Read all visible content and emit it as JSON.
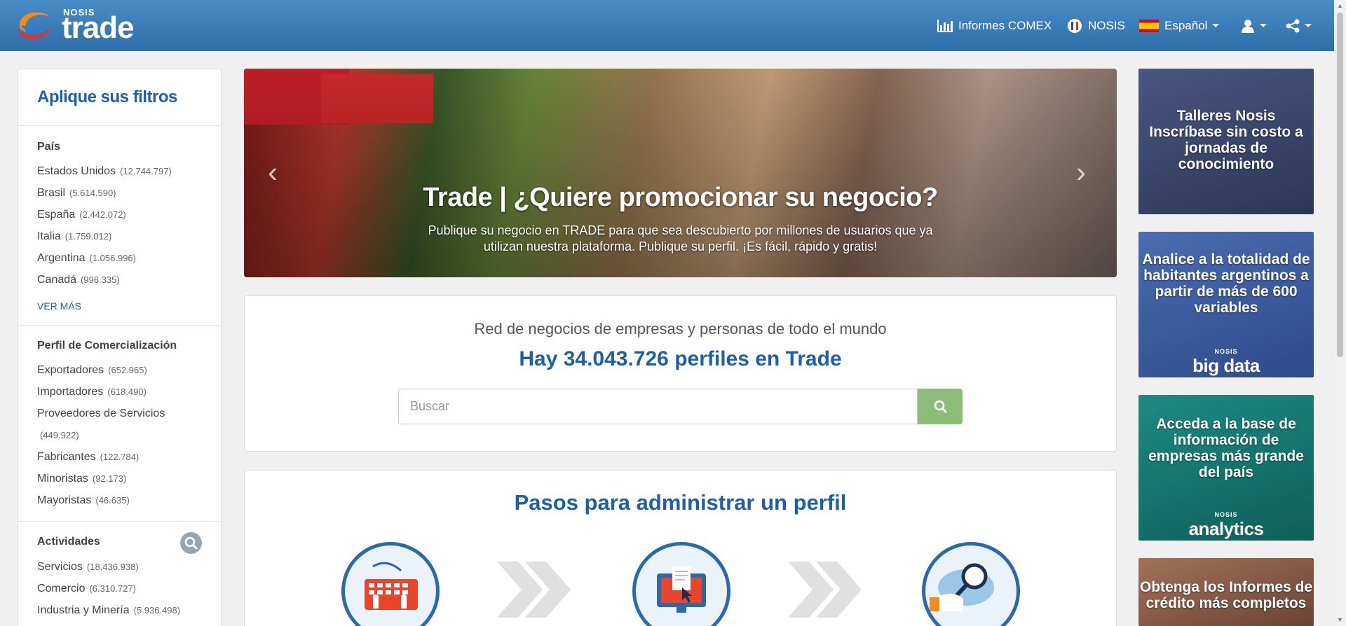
{
  "header": {
    "logo_small": "NOSIS",
    "logo_big": "trade",
    "nav": {
      "informes": "Informes COMEX",
      "nosis": "NOSIS",
      "language": "Español"
    },
    "icons": [
      "bar-chart-icon",
      "nosis-logo-icon",
      "spain-flag-icon",
      "user-icon",
      "share-icon"
    ]
  },
  "sidebar": {
    "title": "Aplique sus filtros",
    "pais": {
      "heading": "País",
      "items": [
        {
          "label": "Estados Unidos",
          "count": "(12.744.797)"
        },
        {
          "label": "Brasil",
          "count": "(5.614.590)"
        },
        {
          "label": "España",
          "count": "(2.442.072)"
        },
        {
          "label": "Italia",
          "count": "(1.759.012)"
        },
        {
          "label": "Argentina",
          "count": "(1.056.996)"
        },
        {
          "label": "Canadá",
          "count": "(996.335)"
        }
      ],
      "more": "VER MÁS"
    },
    "perfil": {
      "heading": "Perfil de Comercialización",
      "items": [
        {
          "label": "Exportadores",
          "count": "(652.965)"
        },
        {
          "label": "Importadores",
          "count": "(618.490)"
        },
        {
          "label": "Proveedores de Servicios",
          "count": "(449.922)"
        },
        {
          "label": "Fabricantes",
          "count": "(122.784)"
        },
        {
          "label": "Minoristas",
          "count": "(92.173)"
        },
        {
          "label": "Mayoristas",
          "count": "(46.635)"
        }
      ]
    },
    "actividades": {
      "heading": "Actividades",
      "items": [
        {
          "label": "Servicios",
          "count": "(18.436.938)"
        },
        {
          "label": "Comercio",
          "count": "(6.310.727)"
        },
        {
          "label": "Industria y Minería",
          "count": "(5.936.498)"
        }
      ]
    }
  },
  "carousel": {
    "title": "Trade | ¿Quiere promocionar su negocio?",
    "text": "Publique su negocio en TRADE para que sea descubierto por millones de usuarios que ya utilizan nuestra plataforma. Publique su perfil. ¡Es fácil, rápido y gratis!"
  },
  "search": {
    "subtitle": "Red de negocios de empresas y personas de todo el mundo",
    "count": "Hay 34.043.726 perfiles en Trade",
    "placeholder": "Buscar"
  },
  "steps": {
    "title": "Pasos para administrar un perfil"
  },
  "ads": [
    {
      "text": "Talleres Nosis Inscríbase sin costo a jornadas de conocimiento",
      "color": "#3d4a73"
    },
    {
      "text": "Analice a la totalidad de habitantes argentinos a partir de más de 600 variables",
      "brand_small": "NOSIS",
      "brand_big": "big data",
      "color": "#3a5894"
    },
    {
      "text": "Acceda a la base de información de empresas más grande del país",
      "brand_small": "NOSIS",
      "brand_big": "analytics",
      "color": "#14706b"
    },
    {
      "text": "Obtenga los Informes de crédito más completos",
      "color": "#8a5a44"
    }
  ]
}
